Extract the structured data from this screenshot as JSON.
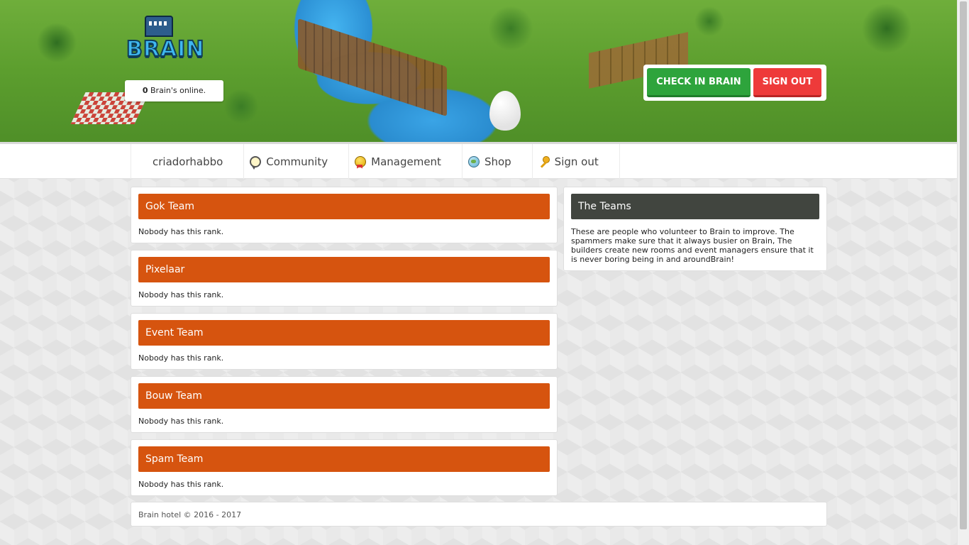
{
  "header": {
    "logo_text": "BRAIN",
    "online_count": "0",
    "online_label": " Brain's online.",
    "checkin_label": "CHECK IN BRAIN",
    "signout_label": "SIGN OUT"
  },
  "nav": {
    "items": [
      {
        "label": "criadorhabbo",
        "icon": ""
      },
      {
        "label": "Community",
        "icon": "chat-bubble-icon"
      },
      {
        "label": "Management",
        "icon": "medal-icon"
      },
      {
        "label": "Shop",
        "icon": "globe-icon"
      },
      {
        "label": "Sign out",
        "icon": "key-icon"
      }
    ]
  },
  "ranks": [
    {
      "title": "Gok Team",
      "text": "Nobody has this rank."
    },
    {
      "title": "Pixelaar",
      "text": "Nobody has this rank."
    },
    {
      "title": "Event Team",
      "text": "Nobody has this rank."
    },
    {
      "title": "Bouw Team",
      "text": "Nobody has this rank."
    },
    {
      "title": "Spam Team",
      "text": "Nobody has this rank."
    }
  ],
  "teams_info": {
    "title": "The Teams",
    "text": "These are people who volunteer to Brain to improve. The spammers make sure that it always busier on Brain, The builders create new rooms and event managers ensure that it is never boring being in and aroundBrain!"
  },
  "footer": {
    "text": "Brain hotel © 2016 - 2017"
  },
  "colors": {
    "rank_bar": "#d6540f",
    "info_bar": "#41453f",
    "checkin_button": "#2ea43c",
    "signout_button": "#ee3a3a"
  }
}
